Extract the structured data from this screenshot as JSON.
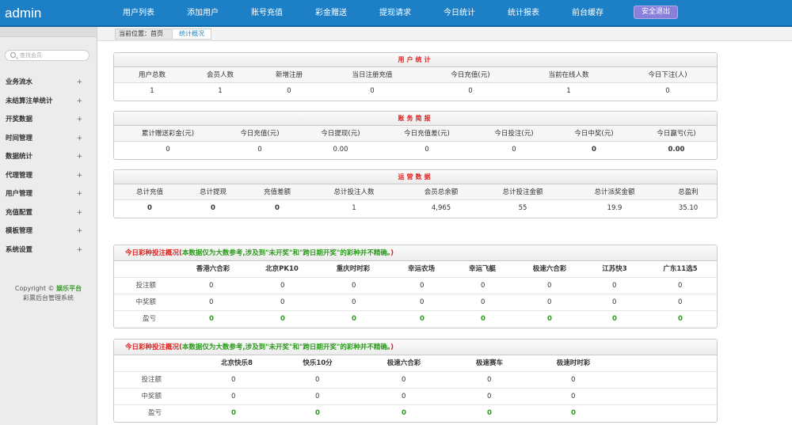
{
  "app": {
    "logo": "admin"
  },
  "topnav": [
    {
      "label": "用户列表"
    },
    {
      "label": "添加用户"
    },
    {
      "label": "账号充值"
    },
    {
      "label": "彩金赠送"
    },
    {
      "label": "提现请求"
    },
    {
      "label": "今日统计"
    },
    {
      "label": "统计报表"
    },
    {
      "label": "前台缓存"
    }
  ],
  "logout_label": "安全退出",
  "sidebar": {
    "search_placeholder": "查找会员",
    "items": [
      {
        "label": "业务流水"
      },
      {
        "label": "未结算注单统计"
      },
      {
        "label": "开奖数据"
      },
      {
        "label": "时间管理"
      },
      {
        "label": "数据统计"
      },
      {
        "label": "代理管理"
      },
      {
        "label": "用户管理"
      },
      {
        "label": "充值配置"
      },
      {
        "label": "模板管理"
      },
      {
        "label": "系统设置"
      }
    ],
    "copyright_prefix": "Copyright ©",
    "brand": "娱乐平台",
    "system_name": "彩票后台管理系统"
  },
  "breadcrumb": {
    "position": "当前位置：首页",
    "current": "统计概况"
  },
  "user_stats": {
    "title": "用户统计",
    "headers": [
      "用户总数",
      "会员人数",
      "新增注册",
      "当日注册充值",
      "今日充值(元)",
      "当前在线人数",
      "今日下注(人)"
    ],
    "values": [
      "1",
      "1",
      "0",
      "0",
      "0",
      "1",
      "0"
    ]
  },
  "account_brief": {
    "title": "账务简报",
    "headers": [
      "累计赠送彩金(元)",
      "今日充值(元)",
      "今日提现(元)",
      "今日充值差(元)",
      "今日投注(元)",
      "今日中奖(元)",
      "今日赢亏(元)"
    ],
    "values": [
      "0",
      "0",
      "0.00",
      "0",
      "0",
      "0",
      "0.00"
    ]
  },
  "operation_data": {
    "title": "运营数据",
    "headers": [
      "总计充值",
      "总计提现",
      "充值差额",
      "总计投注人数",
      "会员总余额",
      "总计投注金额",
      "总计派奖金额",
      "总盈利"
    ],
    "values": [
      "0",
      "0",
      "0",
      "1",
      "4,965",
      "55",
      "19.9",
      "35.10"
    ]
  },
  "lottery1": {
    "title_prefix": "今日彩种投注概况(",
    "title_note": "本数据仅为大数参考,涉及到\"未开奖\"和\"跨日期开奖\"的彩种并不精确。",
    "title_suffix": ")",
    "columns": [
      "香港六合彩",
      "北京PK10",
      "重庆时时彩",
      "幸运农场",
      "幸运飞艇",
      "极速六合彩",
      "江苏快3",
      "广东11选5"
    ],
    "rows": [
      {
        "label": "投注额",
        "values": [
          "0",
          "0",
          "0",
          "0",
          "0",
          "0",
          "0",
          "0"
        ]
      },
      {
        "label": "中奖额",
        "values": [
          "0",
          "0",
          "0",
          "0",
          "0",
          "0",
          "0",
          "0"
        ]
      },
      {
        "label": "盈亏",
        "values": [
          "0",
          "0",
          "0",
          "0",
          "0",
          "0",
          "0",
          "0"
        ]
      }
    ]
  },
  "lottery2": {
    "title_prefix": "今日彩种投注概况(",
    "title_note": "本数据仅为大数参考,涉及到\"未开奖\"和\"跨日期开奖\"的彩种并不精确。",
    "title_suffix": ")",
    "columns": [
      "北京快乐8",
      "快乐10分",
      "极速六合彩",
      "极速赛车",
      "极速时时彩"
    ],
    "rows": [
      {
        "label": "投注额",
        "values": [
          "0",
          "0",
          "0",
          "0",
          "0"
        ]
      },
      {
        "label": "中奖额",
        "values": [
          "0",
          "0",
          "0",
          "0",
          "0"
        ]
      },
      {
        "label": "盈亏",
        "values": [
          "0",
          "0",
          "0",
          "0",
          "0"
        ]
      }
    ]
  },
  "colors": {
    "topbar": "#1d7fc6",
    "accent_red": "#e02020",
    "accent_green": "#2a9a1a",
    "logout": "#8b80d9"
  }
}
